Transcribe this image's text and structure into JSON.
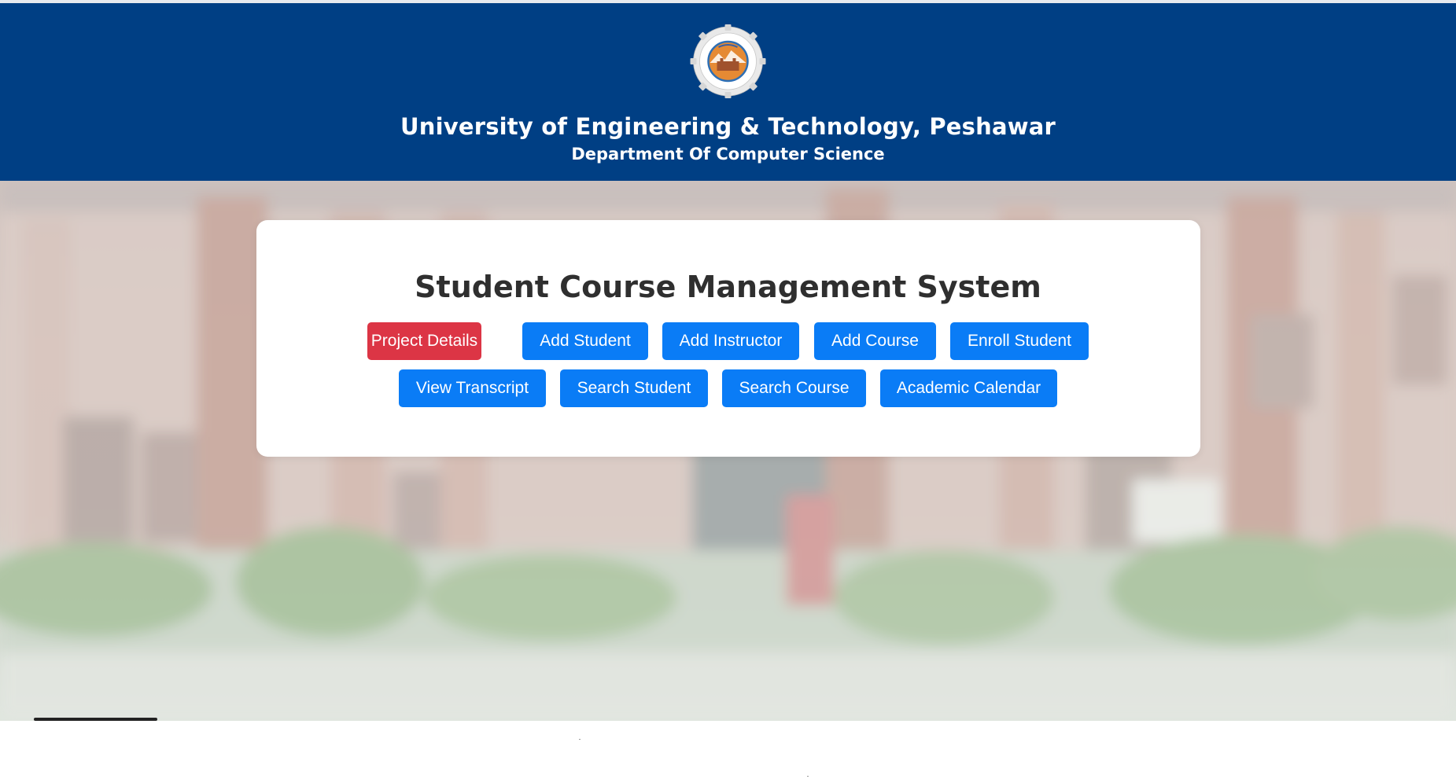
{
  "header": {
    "university": "University of Engineering & Technology, Peshawar",
    "department": "Department Of Computer Science",
    "logo_icon": "university-seal-icon",
    "background_color": "#003f84"
  },
  "main": {
    "title": "Student Course Management System",
    "buttons_row1": [
      {
        "label": "Project Details",
        "color": "#dc3545"
      },
      {
        "label": "Add Student",
        "color": "#0a7cf6"
      },
      {
        "label": "Add Instructor",
        "color": "#0a7cf6"
      },
      {
        "label": "Add Course",
        "color": "#0a7cf6"
      },
      {
        "label": "Enroll Student",
        "color": "#0a7cf6"
      }
    ],
    "buttons_row2": [
      {
        "label": "View Transcript",
        "color": "#0a7cf6"
      },
      {
        "label": "Search Student",
        "color": "#0a7cf6"
      },
      {
        "label": "Search Course",
        "color": "#0a7cf6"
      },
      {
        "label": "Academic Calendar",
        "color": "#0a7cf6"
      }
    ]
  },
  "background": {
    "image": "blurred-campus-building-photo"
  }
}
